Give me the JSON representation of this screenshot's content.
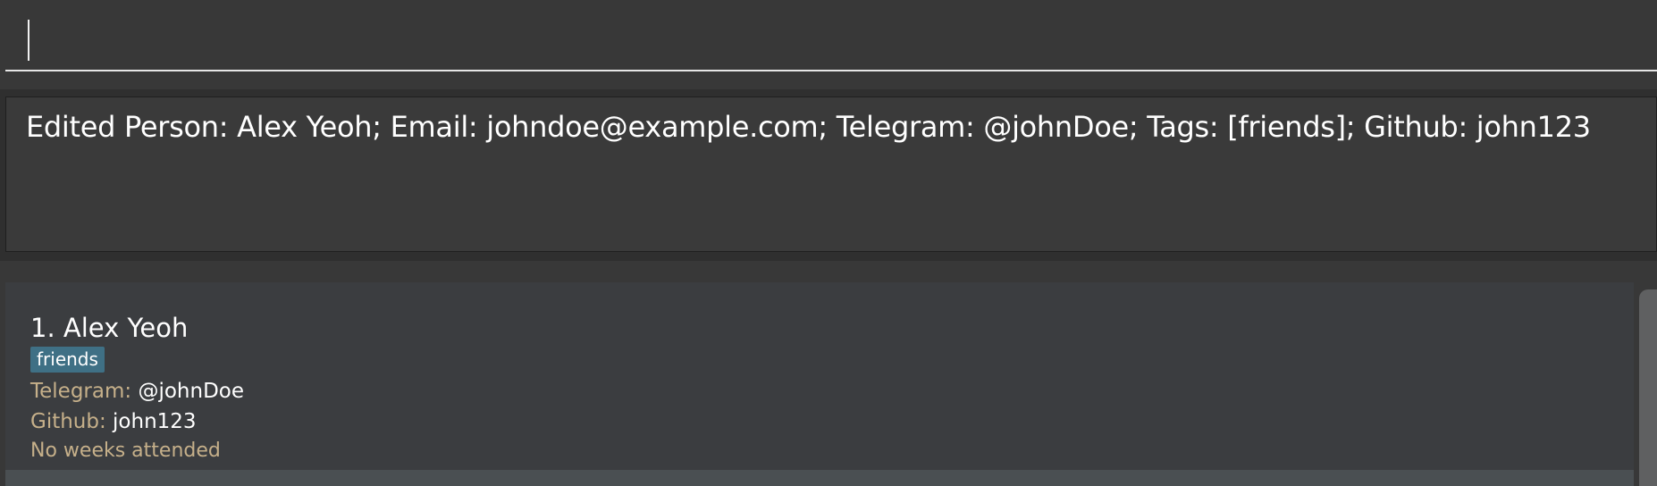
{
  "command_box": {
    "value": ""
  },
  "result_display": {
    "message": "Edited Person: Alex Yeoh; Email: johndoe@example.com; Telegram: @johnDoe; Tags: [friends]; Github: john123"
  },
  "person_list": {
    "items": [
      {
        "index_name": "1. Alex Yeoh",
        "tags": [
          "friends"
        ],
        "telegram_label": "Telegram:",
        "telegram_value": "@johnDoe",
        "github_label": "Github:",
        "github_value": "john123",
        "weeks_text": "No weeks attended"
      }
    ]
  },
  "colors": {
    "background": "#383838",
    "tag_background": "#3f7085",
    "label_color": "#c6b08a",
    "text_color": "#ffffff"
  }
}
